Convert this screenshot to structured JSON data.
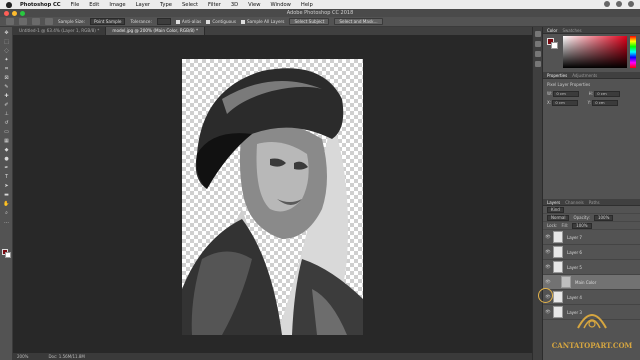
{
  "menubar": {
    "app": "Photoshop CC",
    "items": [
      "File",
      "Edit",
      "Image",
      "Layer",
      "Type",
      "Select",
      "Filter",
      "3D",
      "View",
      "Window",
      "Help"
    ]
  },
  "window": {
    "title": "Adobe Photoshop CC 2018"
  },
  "options": {
    "sample_size_label": "Sample Size:",
    "sample_size_value": "Point Sample",
    "tolerance_label": "Tolerance:",
    "anti_alias": "Anti-alias",
    "contiguous": "Contiguous",
    "sample_all_layers": "Sample All Layers",
    "select_subject": "Select Subject",
    "select_and_mask": "Select and Mask..."
  },
  "tabs": [
    {
      "label": "Untitled-1 @ 63.4% (Layer 1, RGB/8) *"
    },
    {
      "label": "model.jpg @ 200% (Main Color, RGB/8) *"
    }
  ],
  "status": {
    "zoom": "200%",
    "doc": "Doc: 1.56M/11.8M"
  },
  "color_panel": {
    "tabs": [
      "Color",
      "Swatches"
    ]
  },
  "properties_panel": {
    "tabs": [
      "Properties",
      "Adjustments"
    ],
    "heading": "Pixel Layer Properties",
    "w_label": "W:",
    "w_value": "0 cm",
    "h_label": "H:",
    "h_value": "0 cm",
    "x_label": "X:",
    "x_value": "0 cm",
    "y_label": "Y:",
    "y_value": "0 cm"
  },
  "layers_panel": {
    "tabs": [
      "Layers",
      "Channels",
      "Paths"
    ],
    "kind_label": "Kind",
    "blend_mode": "Normal",
    "opacity_label": "Opacity:",
    "opacity_value": "100%",
    "lock_label": "Lock:",
    "fill_label": "Fill:",
    "fill_value": "100%",
    "layers": [
      {
        "name": "Layer 7",
        "selected": false,
        "indented": false
      },
      {
        "name": "Layer 6",
        "selected": false,
        "indented": false
      },
      {
        "name": "Layer 5",
        "selected": false,
        "indented": false
      },
      {
        "name": "Main Color",
        "selected": true,
        "indented": true
      },
      {
        "name": "Layer 4",
        "selected": false,
        "indented": false
      },
      {
        "name": "Layer 3",
        "selected": false,
        "indented": false
      }
    ]
  },
  "colors": {
    "foreground": "#7a0b12",
    "background": "#ffffff",
    "accent": "#d6a640"
  },
  "watermark": {
    "text": "CANTATOPART.COM"
  }
}
